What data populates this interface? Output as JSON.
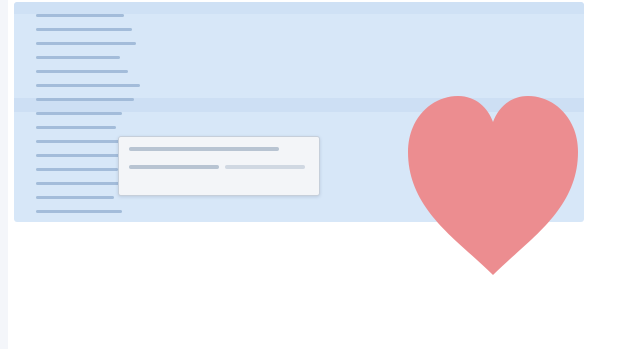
{
  "colors": {
    "panel_bg": "#d7e7f8",
    "list_text": "#9db7d6",
    "input_bg": "#f3f5f8",
    "input_border": "#c6cfda",
    "heart_fill": "#ec8d90",
    "page_bg": "#ffffff"
  },
  "list": {
    "items": [
      {
        "label": ""
      },
      {
        "label": ""
      },
      {
        "label": ""
      },
      {
        "label": ""
      },
      {
        "label": ""
      },
      {
        "label": ""
      },
      {
        "label": ""
      },
      {
        "label": ""
      },
      {
        "label": ""
      },
      {
        "label": ""
      },
      {
        "label": ""
      },
      {
        "label": ""
      },
      {
        "label": ""
      },
      {
        "label": ""
      },
      {
        "label": ""
      }
    ]
  },
  "input": {
    "value": "",
    "placeholder": ""
  },
  "heart": {
    "icon": "heart-icon"
  }
}
